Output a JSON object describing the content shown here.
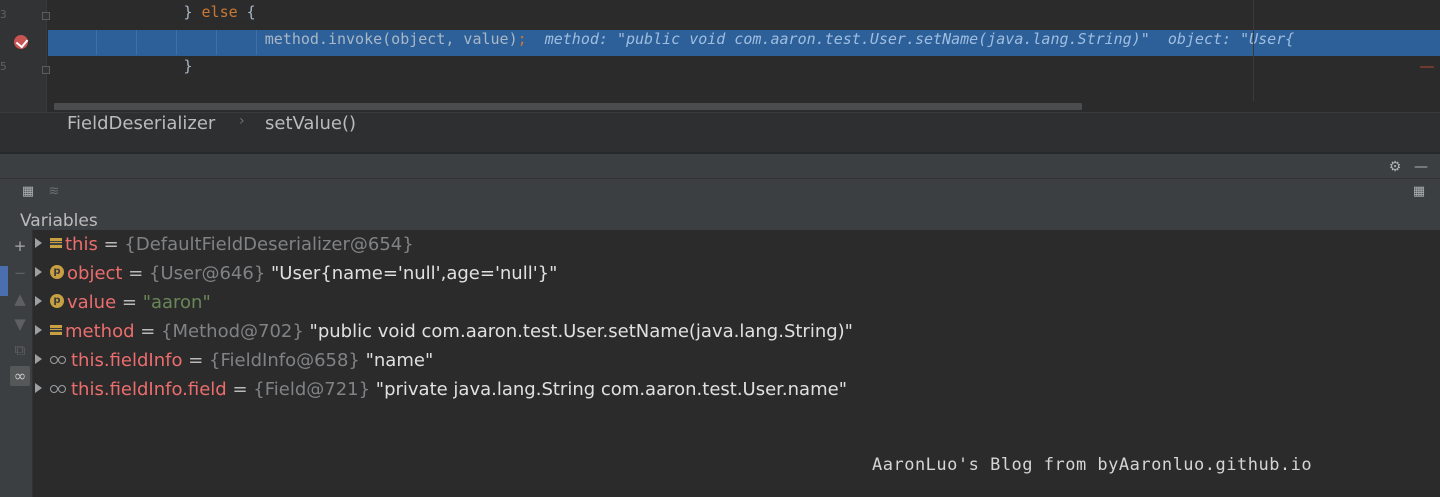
{
  "editor": {
    "line_numbers": [
      "3",
      "",
      "5"
    ],
    "lines": [
      {
        "indent": "     ",
        "keyword_pre": "} ",
        "keyword": "else",
        "rest": " {"
      },
      {
        "indent": "        ",
        "code": "method.invoke(object, value)",
        "semicolon": ";",
        "hint": "  method: \"public void com.aaron.test.User.setName(java.lang.String)\"  object: \"User{"
      },
      {
        "indent": "     ",
        "code": "}"
      }
    ]
  },
  "breadcrumb": {
    "items": [
      "FieldDeserializer",
      "setValue()"
    ],
    "separator": "›"
  },
  "panel": {
    "settings_icon": "⚙",
    "minimize_icon": "—",
    "layout_icon": "▦"
  },
  "toolbar": {
    "table_icon": "▦",
    "list_icon": "≋"
  },
  "variables": {
    "title": "Variables",
    "rows": [
      {
        "icon": "field",
        "name": "this",
        "eq": " = ",
        "type": "{DefaultFieldDeserializer@654}",
        "value": ""
      },
      {
        "icon": "param",
        "name": "object",
        "eq": " = ",
        "type": "{User@646}",
        "value": " \"User{name='null',age='null'}\""
      },
      {
        "icon": "param",
        "name": "value",
        "eq": " = ",
        "type": "",
        "value": "\"aaron\""
      },
      {
        "icon": "field",
        "name": "method",
        "eq": " = ",
        "type": "{Method@702}",
        "value": " \"public void com.aaron.test.User.setName(java.lang.String)\""
      },
      {
        "icon": "watch",
        "name": "this.fieldInfo",
        "eq": " = ",
        "type": "{FieldInfo@658}",
        "value": " \"name\""
      },
      {
        "icon": "watch",
        "name": "this.fieldInfo.field",
        "eq": " = ",
        "type": "{Field@721}",
        "value": " \"private java.lang.String com.aaron.test.User.name\""
      }
    ]
  },
  "side_tools": [
    "+",
    "−",
    "▲",
    "▼",
    "⧉",
    "∞"
  ],
  "watermark": "AaronLuo's Blog from byAaronluo.github.io",
  "colors": {
    "highlight": "#2d6099",
    "keyword": "#cc7832",
    "var_name": "#ec6d6d",
    "string_green": "#6a8759"
  }
}
